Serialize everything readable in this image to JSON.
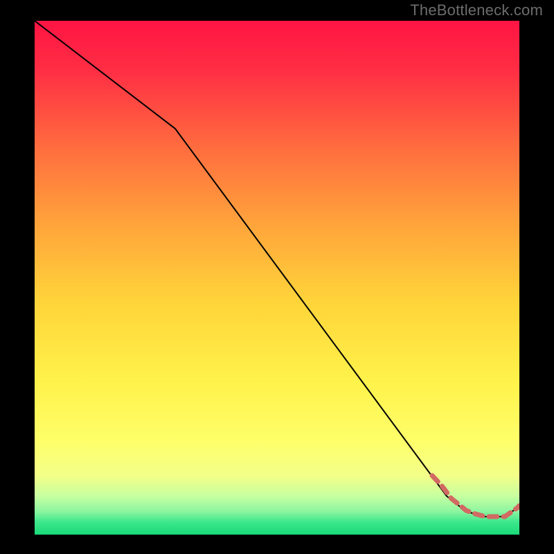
{
  "attribution": "TheBottleneck.com",
  "chart_data": {
    "type": "line",
    "title": "",
    "xlabel": "",
    "ylabel": "",
    "xlim": [
      0,
      100
    ],
    "ylim": [
      0,
      100
    ],
    "grid": false,
    "legend": false,
    "colors": {
      "gradient_top": "#ff1846",
      "gradient_mid_upper": "#ff7a3c",
      "gradient_mid": "#ffd23a",
      "gradient_lower": "#fff85a",
      "gradient_bottom": "#26e07e",
      "line": "#000000",
      "marker": "#d16a63"
    },
    "series": [
      {
        "name": "curve",
        "style": "solid-thin-black",
        "x": [
          0,
          29,
          85,
          89,
          93,
          97,
          100
        ],
        "y": [
          100,
          79,
          7.5,
          4.5,
          3.5,
          3.5,
          5.5
        ]
      },
      {
        "name": "markers-dashed",
        "style": "dashed-salmon-with-dots",
        "x": [
          82,
          84,
          86,
          88,
          89,
          91,
          93,
          95,
          97,
          100
        ],
        "y": [
          11.5,
          9.5,
          7,
          5.5,
          4.7,
          4,
          3.5,
          3.5,
          3.5,
          5.5
        ]
      }
    ]
  }
}
